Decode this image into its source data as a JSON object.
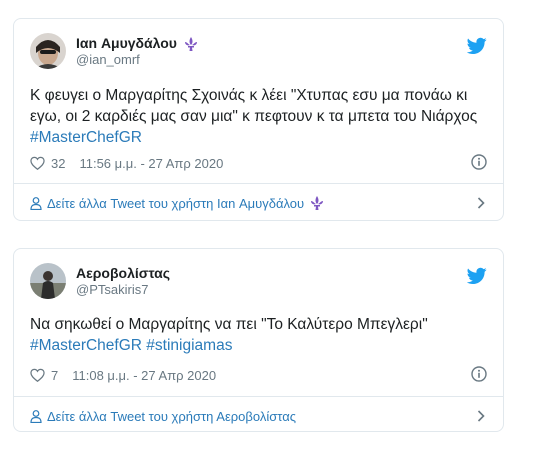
{
  "tweets": [
    {
      "author": {
        "display_name": "Ιαn Αμυγδάλου",
        "handle": "@ian_omrf"
      },
      "text_line1": "Κ φευγει ο Μαργαρίτης Σχοινάς κ λέει \"Χτυπας εσυ μα πονάω κι",
      "text_line2": "εγω, οι 2 καρδιές μας σαν μια\" κ πεφτουν κ τα μπετα του Νιάρχος",
      "hashtags": [
        "#MasterChefGR"
      ],
      "likes": "32",
      "timestamp": "11:56 μ.μ. - 27 Απρ 2020",
      "more_link": "Δείτε άλλα Tweet του χρήστη Ιαn Αμυγδάλου"
    },
    {
      "author": {
        "display_name": "Αεροβολίστας",
        "handle": "@PTsakiris7"
      },
      "text_line1": "Να σηκωθεί ο Μαργαρίτης να πει \"Το Καλύτερο Μπεγλερι\"",
      "hashtags": [
        "#MasterChefGR",
        "#stinigiamas"
      ],
      "likes": "7",
      "timestamp": "11:08 μ.μ. - 27 Απρ 2020",
      "more_link": "Δείτε άλλα Tweet του χρήστη Αεροβολίστας"
    }
  ],
  "icons": {
    "brand_color": "#1da1f2",
    "link_color": "#2b7bb9",
    "fleur_color": "#7e57c2",
    "names": [
      "avatar",
      "fleur-de-lis-icon",
      "twitter-bird-icon",
      "heart-icon",
      "info-icon",
      "person-icon",
      "chevron-right-icon"
    ]
  }
}
